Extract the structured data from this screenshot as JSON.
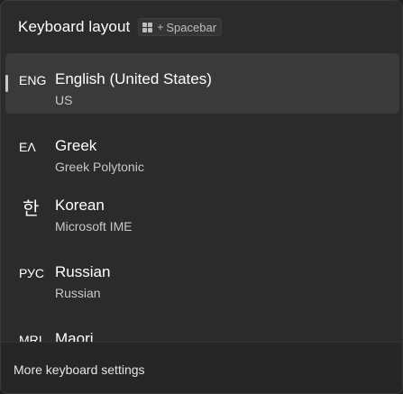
{
  "header": {
    "title": "Keyboard layout",
    "shortcut": {
      "key_icon": "windows-key-icon",
      "plus": "+",
      "key": "Spacebar"
    }
  },
  "layouts": [
    {
      "abbr": "ENG",
      "language": "English (United States)",
      "layout": "US",
      "selected": true
    },
    {
      "abbr": "ΕΛ",
      "language": "Greek",
      "layout": "Greek Polytonic",
      "selected": false
    },
    {
      "abbr": "한",
      "language": "Korean",
      "layout": "Microsoft IME",
      "selected": false
    },
    {
      "abbr": "РУС",
      "language": "Russian",
      "layout": "Russian",
      "selected": false
    },
    {
      "abbr": "MRI",
      "language": "Maori",
      "layout": "",
      "selected": false
    }
  ],
  "footer": {
    "link": "More keyboard settings"
  },
  "colors": {
    "background": "#2b2b2b",
    "selected_item": "#3a3a3a",
    "footer": "#262626"
  }
}
